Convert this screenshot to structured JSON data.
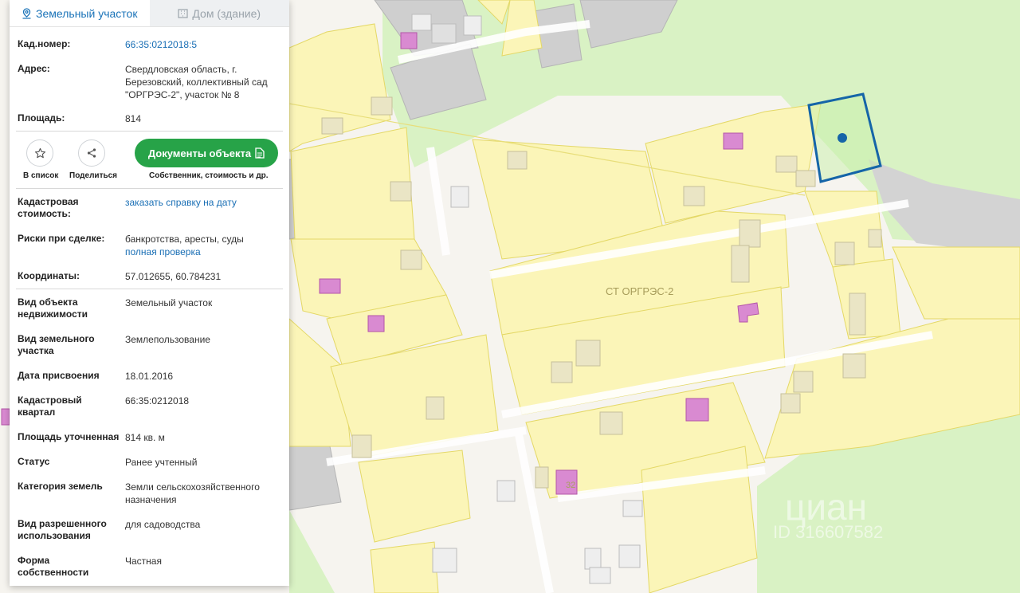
{
  "tabs": {
    "land": "Земельный участок",
    "house": "Дом (здание)"
  },
  "info": {
    "cad_label": "Кад.номер:",
    "cad_value": "66:35:0212018:5",
    "address_label": "Адрес:",
    "address_value": "Свердловская область, г. Березовский, коллективный сад \"ОРГРЭС-2\", участок № 8",
    "area_label": "Площадь:",
    "area_value": "814"
  },
  "actions": {
    "list_label": "В список",
    "share_label": "Поделиться",
    "docs_label": "Документы объекта",
    "docs_sub": "Собственник, стоимость и др."
  },
  "details": {
    "cost_label": "Кадастровая стоимость:",
    "cost_value": "заказать справку на дату",
    "risk_label": "Риски при сделке:",
    "risk_value": "банкротства, аресты, суды",
    "risk_link": "полная проверка",
    "coord_label": "Координаты:",
    "coord_value": "57.012655, 60.784231"
  },
  "props": [
    {
      "label": "Вид объекта недвижимости",
      "value": "Земельный участок"
    },
    {
      "label": "Вид земельного участка",
      "value": "Землепользование"
    },
    {
      "label": "Дата присвоения",
      "value": "18.01.2016"
    },
    {
      "label": "Кадастровый квартал",
      "value": "66:35:0212018"
    },
    {
      "label": "Площадь уточненная",
      "value": "814 кв. м"
    },
    {
      "label": "Статус",
      "value": "Ранее учтенный"
    },
    {
      "label": "Категория земель",
      "value": "Земли сельскохозяйственного назначения"
    },
    {
      "label": "Вид разрешенного использования",
      "value": "для садоводства"
    },
    {
      "label": "Форма собственности",
      "value": "Частная"
    }
  ],
  "map": {
    "area_label": "СТ ОРГРЭС-2",
    "plot_number": "32",
    "watermark": "циан",
    "watermark_id": "ID 316607582",
    "colors": {
      "parcel_fill": "#fbf5b8",
      "parcel_stroke": "#e4d866",
      "green": "#d9f2c4",
      "selected": "#1565a8",
      "marker": "#1565a8"
    }
  }
}
